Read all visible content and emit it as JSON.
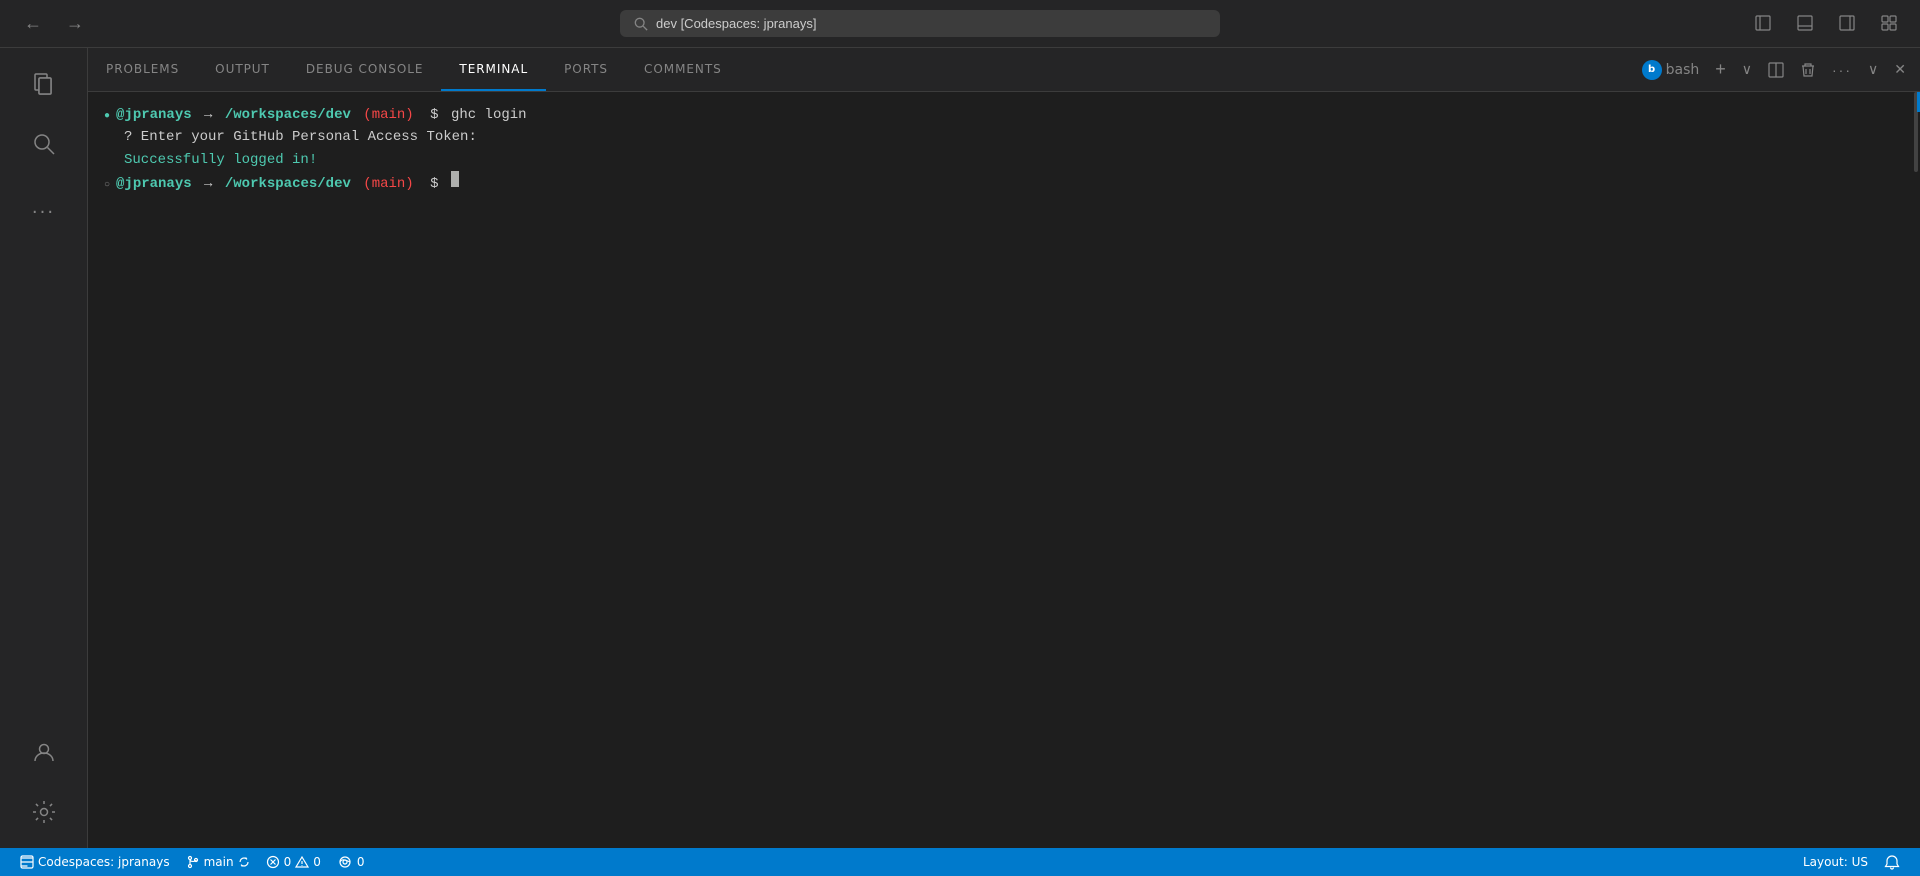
{
  "titlebar": {
    "back_label": "←",
    "forward_label": "→",
    "search_value": "dev [Codespaces: jpranays]",
    "search_placeholder": "dev [Codespaces: jpranays]",
    "layout_icon_label": "⬜",
    "layout2_icon_label": "⬜",
    "layout3_icon_label": "⬜",
    "layout4_icon_label": "⬜"
  },
  "activitybar": {
    "items": [
      {
        "name": "explorer",
        "icon": "⧉",
        "label": "Explorer"
      },
      {
        "name": "search",
        "icon": "🔍",
        "label": "Search"
      },
      {
        "name": "more",
        "icon": "···",
        "label": "More"
      }
    ],
    "bottom_items": [
      {
        "name": "account",
        "icon": "👤",
        "label": "Account"
      },
      {
        "name": "settings",
        "icon": "⚙",
        "label": "Settings"
      }
    ]
  },
  "panel": {
    "tabs": [
      {
        "id": "problems",
        "label": "PROBLEMS"
      },
      {
        "id": "output",
        "label": "OUTPUT"
      },
      {
        "id": "debug-console",
        "label": "DEBUG CONSOLE"
      },
      {
        "id": "terminal",
        "label": "TERMINAL",
        "active": true
      },
      {
        "id": "ports",
        "label": "PORTS"
      },
      {
        "id": "comments",
        "label": "COMMENTS"
      }
    ],
    "actions": {
      "bash_label": "bash",
      "new_terminal": "+",
      "launch_profile": "∨",
      "split_terminal": "⊟",
      "delete_terminal": "🗑",
      "more_actions": "···",
      "collapse": "∨",
      "close": "✕"
    }
  },
  "terminal": {
    "lines": [
      {
        "type": "command",
        "user": "@jpranays",
        "arrow": "→",
        "path": "/workspaces/dev",
        "branch": "(main)",
        "prompt": "$",
        "command": "ghc login"
      },
      {
        "type": "question",
        "text": "?  Enter your GitHub Personal Access Token:"
      },
      {
        "type": "success",
        "text": "Successfully logged in!"
      },
      {
        "type": "prompt",
        "user": "@jpranays",
        "arrow": "→",
        "path": "/workspaces/dev",
        "branch": "(main)",
        "prompt": "$",
        "cursor": true
      }
    ]
  },
  "statusbar": {
    "codespaces_label": "Codespaces: jpranays",
    "branch_icon": "⎇",
    "branch_label": "main",
    "sync_icon": "↻",
    "error_icon": "⊗",
    "error_count": "0",
    "warning_icon": "△",
    "warning_count": "0",
    "port_icon": "((·))",
    "port_count": "0",
    "layout_label": "Layout: US",
    "bell_icon": "🔔"
  },
  "colors": {
    "accent": "#007acc",
    "terminal_bg": "#1e1e1e",
    "sidebar_bg": "#252526",
    "user_color": "#4ec9b0",
    "branch_color": "#f44747",
    "success_color": "#4ec9b0",
    "active_tab_border": "#007acc"
  }
}
